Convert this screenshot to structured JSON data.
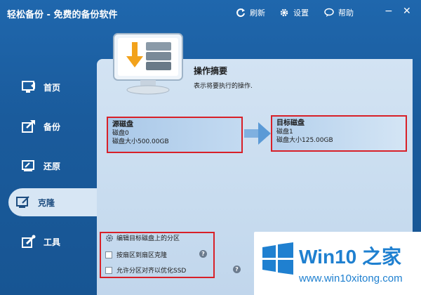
{
  "titlebar": {
    "app_title": "轻松备份 - 免费的备份软件",
    "refresh_label": "刷新",
    "settings_label": "设置",
    "help_label": "帮助",
    "minimize_glyph": "−",
    "close_glyph": "✕"
  },
  "sidebar": {
    "items": [
      {
        "label": "首页",
        "icon": "monitor-home-icon"
      },
      {
        "label": "备份",
        "icon": "backup-icon"
      },
      {
        "label": "还原",
        "icon": "restore-icon"
      },
      {
        "label": "克隆",
        "icon": "clone-icon",
        "active": true
      },
      {
        "label": "工具",
        "icon": "tools-icon"
      }
    ]
  },
  "main": {
    "summary_title": "操作摘要",
    "summary_desc": "表示将要执行的操作.",
    "source": {
      "title": "源磁盘",
      "disk": "磁盘0",
      "size": "磁盘大小500.00GB"
    },
    "target": {
      "title": "目标磁盘",
      "disk": "磁盘1",
      "size": "磁盘大小125.00GB"
    },
    "options": {
      "edit_partitions": "编辑目标磁盘上的分区",
      "sector_clone": "按扇区到扇区克隆",
      "align_ssd": "允许分区对齐以优化SSD",
      "help_glyph": "?"
    }
  },
  "watermark": {
    "title": "Win10 之家",
    "url": "www.win10xitong.com"
  },
  "colors": {
    "accent_blue": "#1f67ad",
    "highlight_red": "#d82028",
    "panel_bg": "#d3e3f3"
  }
}
